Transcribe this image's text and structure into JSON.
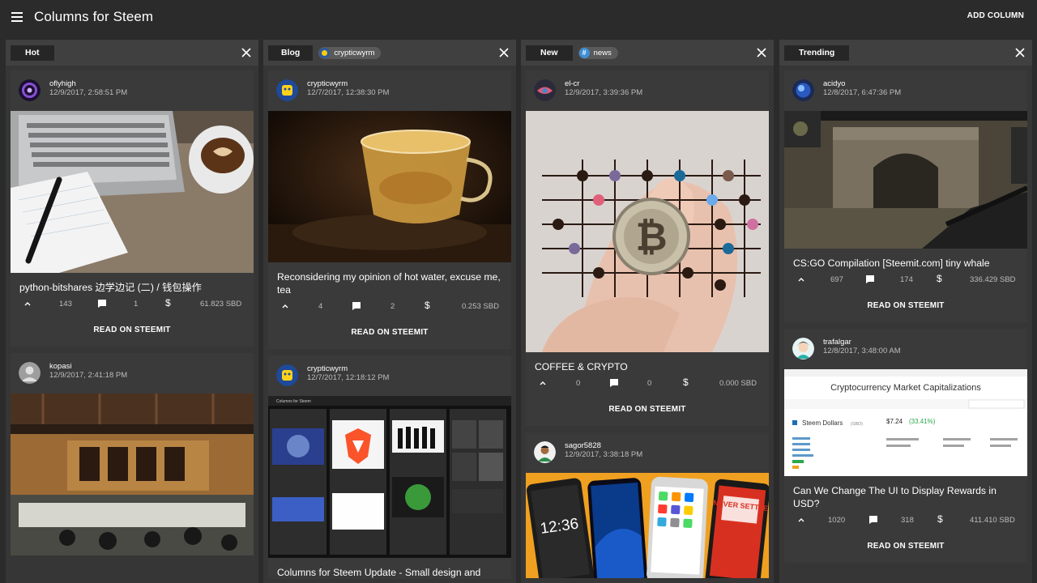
{
  "app": {
    "title": "Columns for Steem",
    "add_column_label": "ADD COLUMN"
  },
  "columns": [
    {
      "title": "Hot",
      "chip": null,
      "posts": [
        {
          "author": "oflyhigh",
          "time": "12/9/2017, 2:58:51 PM",
          "title": "python-bitshares 边学边记 (二) / 钱包操作",
          "votes": "143",
          "comments": "1",
          "payout": "61.823 SBD",
          "read_label": "READ ON STEEMIT"
        },
        {
          "author": "kopasi",
          "time": "12/9/2017, 2:41:18 PM"
        }
      ]
    },
    {
      "title": "Blog",
      "chip": "crypticwyrm",
      "posts": [
        {
          "author": "crypticwyrm",
          "time": "12/7/2017, 12:38:30 PM",
          "title": "Reconsidering my opinion of hot water, excuse me, tea",
          "votes": "4",
          "comments": "2",
          "payout": "0.253 SBD",
          "read_label": "READ ON STEEMIT"
        },
        {
          "author": "crypticwyrm",
          "time": "12/7/2017, 12:18:12 PM",
          "title": "Columns for Steem Update - Small design and"
        }
      ]
    },
    {
      "title": "New",
      "chip": "news",
      "posts": [
        {
          "author": "el-cr",
          "time": "12/9/2017, 3:39:36 PM",
          "title": "COFFEE & CRYPTO",
          "votes": "0",
          "comments": "0",
          "payout": "0.000 SBD",
          "read_label": "READ ON STEEMIT"
        },
        {
          "author": "sagor5828",
          "time": "12/9/2017, 3:38:18 PM"
        }
      ]
    },
    {
      "title": "Trending",
      "chip": null,
      "posts": [
        {
          "author": "acidyo",
          "time": "12/8/2017, 6:47:36 PM",
          "title": "CS:GO Compilation [Steemit.com] tiny whale",
          "votes": "697",
          "comments": "174",
          "payout": "336.429 SBD",
          "read_label": "READ ON STEEMIT"
        },
        {
          "author": "trafalgar",
          "time": "12/8/2017, 3:48:00 AM",
          "title": "Can We Change The UI to Display Rewards in USD?",
          "votes": "1020",
          "comments": "318",
          "payout": "411.410 SBD",
          "read_label": "READ ON STEEMIT"
        }
      ]
    }
  ],
  "thumb_text": {
    "brand": "Columns for Steem",
    "market_title": "Cryptocurrency Market Capitalizations",
    "coin_name": "Steem Dollars",
    "coin_symbol": "(SBD)",
    "coin_price": "$7.24",
    "coin_change": "(33.41%)",
    "phone_time": "12:36",
    "never_settle": "NEVER SETTLE"
  },
  "colors": {
    "background": "#2b2b2b",
    "column_bg": "#363636",
    "card_bg": "#3a3a3a",
    "tab_bg": "#262626",
    "header_bg": "#404040"
  }
}
